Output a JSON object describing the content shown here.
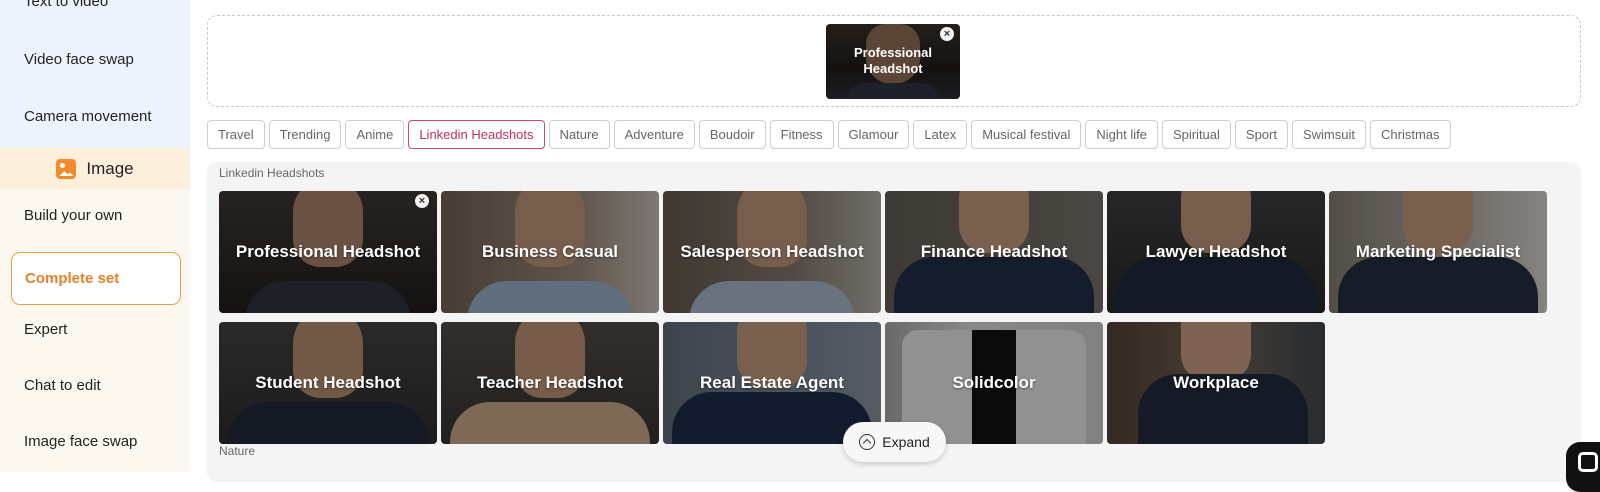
{
  "sidebar": {
    "video_items": [
      "Text to video",
      "Video face swap",
      "Camera movement"
    ],
    "image_section_label": "Image",
    "image_items": [
      "Build your own",
      "Complete set",
      "Expert",
      "Chat to edit",
      "Image face swap"
    ],
    "active_item": "Complete set"
  },
  "upload": {
    "selected_label": "Professional Headshot",
    "remove_glyph": "×"
  },
  "tabs": [
    "Travel",
    "Trending",
    "Anime",
    "Linkedin Headshots",
    "Nature",
    "Adventure",
    "Boudoir",
    "Fitness",
    "Glamour",
    "Latex",
    "Musical festival",
    "Night life",
    "Spiritual",
    "Sport",
    "Swimsuit",
    "Christmas"
  ],
  "active_tab": "Linkedin Headshots",
  "gallery": {
    "sections": [
      {
        "title": "Linkedin Headshots",
        "cards": [
          {
            "label": "Professional Headshot",
            "selected": true
          },
          {
            "label": "Business Casual"
          },
          {
            "label": "Salesperson Headshot"
          },
          {
            "label": "Finance Headshot"
          },
          {
            "label": "Lawyer Headshot"
          },
          {
            "label": "Marketing Specialist"
          },
          {
            "label": "Student Headshot"
          },
          {
            "label": "Teacher Headshot"
          },
          {
            "label": "Real Estate Agent"
          },
          {
            "label": "Solidcolor"
          },
          {
            "label": "Workplace"
          }
        ]
      },
      {
        "title": "Nature",
        "cards": []
      }
    ],
    "expand_label": "Expand",
    "card_remove_glyph": "×"
  },
  "colors": {
    "accent_orange": "#e8812a",
    "active_tab_pink": "#c0325f",
    "video_group_bg": "#edf3fd",
    "image_group_bg": "#fdf8ef"
  },
  "icons": {
    "image_section": "image-icon",
    "remove": "close-icon",
    "expand": "chevron-up-circle-icon",
    "chat": "chat-icon"
  }
}
